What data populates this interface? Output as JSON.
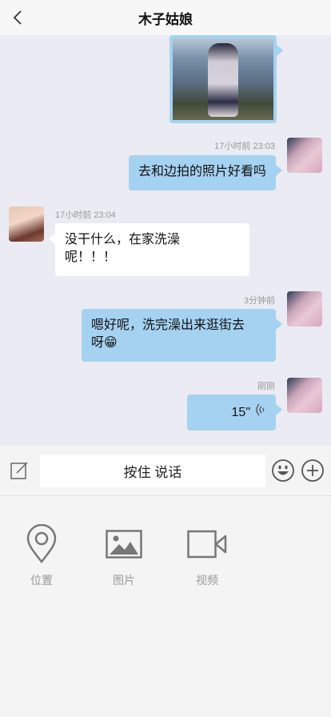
{
  "header": {
    "title": "木子姑娘",
    "back_icon": "back-chevron-icon"
  },
  "messages": [
    {
      "type": "image",
      "side": "me"
    },
    {
      "side": "me",
      "time": "17小时前 23:03",
      "text": "去和边拍的照片好看吗"
    },
    {
      "side": "her",
      "time": "17小时前 23:04",
      "text": "没干什么，在家洗澡\n呢！！！"
    },
    {
      "side": "me",
      "time": "3分钟前",
      "text": "嗯好呢，洗完澡出来逛街去\n呀😁"
    },
    {
      "side": "me",
      "time": "刚刚",
      "type": "voice",
      "duration": "15\""
    }
  ],
  "input_bar": {
    "talk_label": "按住 说话"
  },
  "panel": {
    "items": [
      {
        "label": "位置",
        "icon": "location-pin-icon"
      },
      {
        "label": "图片",
        "icon": "image-icon"
      },
      {
        "label": "视频",
        "icon": "video-camera-icon"
      }
    ]
  },
  "colors": {
    "my_bubble": "#a5d2f1",
    "her_bubble": "#ffffff",
    "chat_bg": "#ebebf3"
  }
}
